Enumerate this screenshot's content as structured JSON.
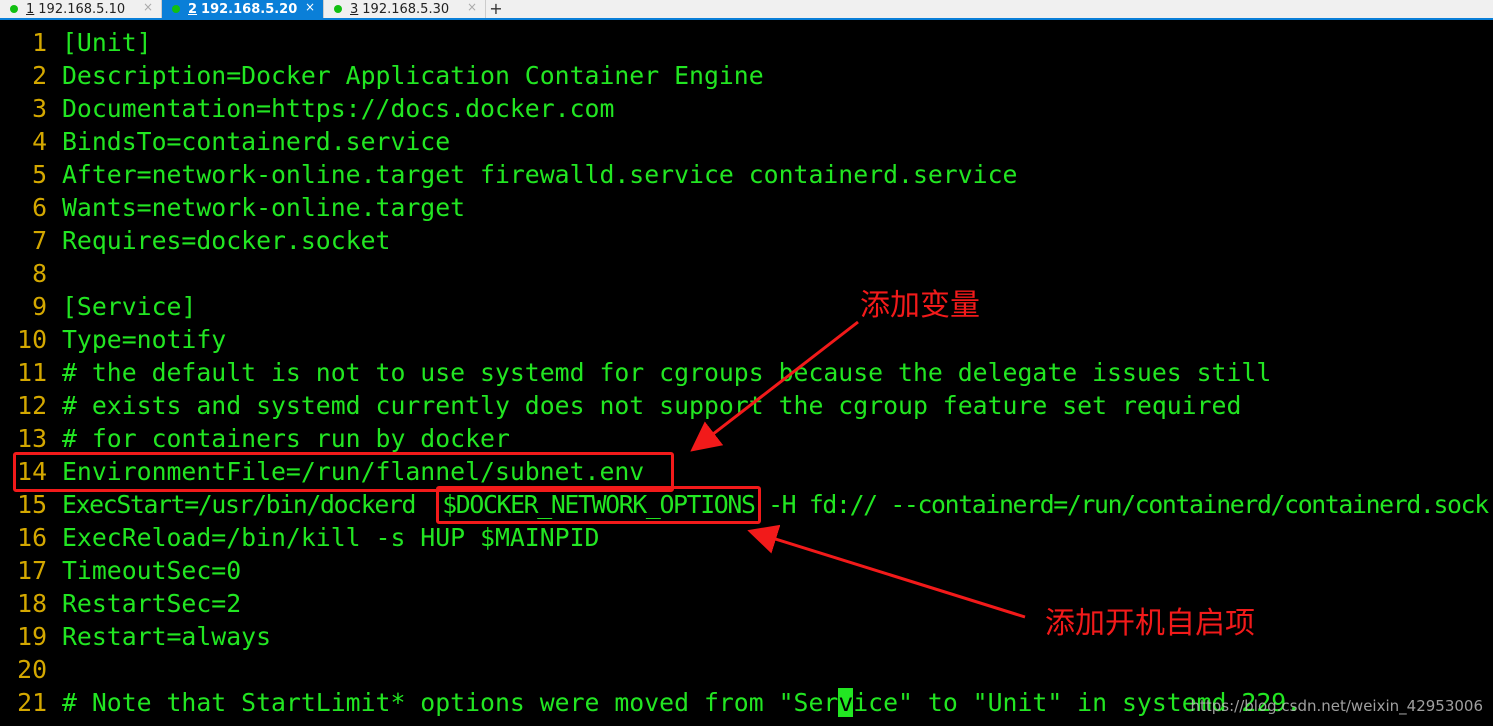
{
  "tabs": [
    {
      "num": "1",
      "label": "192.168.5.10",
      "active": false
    },
    {
      "num": "2",
      "label": "192.168.5.20",
      "active": true
    },
    {
      "num": "3",
      "label": "192.168.5.30",
      "active": false
    }
  ],
  "new_tab": "+",
  "close": "×",
  "lines": [
    {
      "n": "1",
      "t": "[Unit]"
    },
    {
      "n": "2",
      "t": "Description=Docker Application Container Engine"
    },
    {
      "n": "3",
      "t": "Documentation=https://docs.docker.com"
    },
    {
      "n": "4",
      "t": "BindsTo=containerd.service"
    },
    {
      "n": "5",
      "t": "After=network-online.target firewalld.service containerd.service"
    },
    {
      "n": "6",
      "t": "Wants=network-online.target"
    },
    {
      "n": "7",
      "t": "Requires=docker.socket"
    },
    {
      "n": "8",
      "t": ""
    },
    {
      "n": "9",
      "t": "[Service]"
    },
    {
      "n": "10",
      "t": "Type=notify"
    },
    {
      "n": "11",
      "t": "# the default is not to use systemd for cgroups because the delegate issues still"
    },
    {
      "n": "12",
      "t": "# exists and systemd currently does not support the cgroup feature set required"
    },
    {
      "n": "13",
      "t": "# for containers run by docker"
    },
    {
      "n": "14",
      "t": "EnvironmentFile=/run/flannel/subnet.env"
    },
    {
      "n": "15",
      "t": "ExecStart=/usr/bin/dockerd  $DOCKER_NETWORK_OPTIONS -H fd:// --containerd=/run/containerd/containerd.sock"
    },
    {
      "n": "16",
      "t": "ExecReload=/bin/kill -s HUP $MAINPID"
    },
    {
      "n": "17",
      "t": "TimeoutSec=0"
    },
    {
      "n": "18",
      "t": "RestartSec=2"
    },
    {
      "n": "19",
      "t": "Restart=always"
    },
    {
      "n": "20",
      "t": ""
    }
  ],
  "line21": {
    "n": "21",
    "before": "# Note that StartLimit* options were moved from \"Ser",
    "cursor": "v",
    "after": "ice\" to \"Unit\" in systemd 229."
  },
  "annotations": {
    "var": "添加变量",
    "boot": "添加开机自启项"
  },
  "watermark": "https://blog.csdn.net/weixin_42953006",
  "colors": {
    "text": "#22e622",
    "line_number": "#d4a800",
    "annotation": "#f21a1a",
    "active_tab": "#0a7fd8"
  }
}
